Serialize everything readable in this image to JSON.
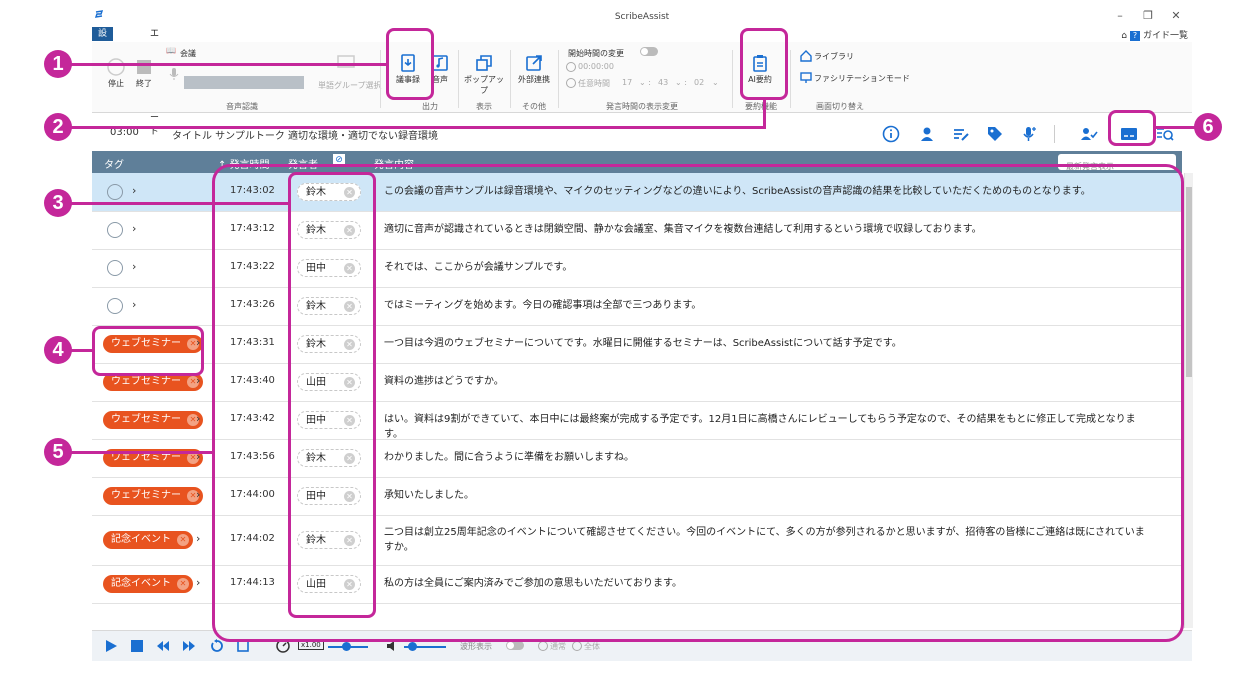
{
  "window": {
    "title": "ScribeAssist"
  },
  "menu": {
    "tabs": [
      "設定",
      "エディットモード"
    ],
    "help": "ガイド一覧"
  },
  "ribbon": {
    "stop": "停止",
    "end": "終了",
    "meeting_label": "会議",
    "wordgroup": "単語グループ選択",
    "group_speech": "音声認識",
    "minutes": "議事録",
    "audio": "音声",
    "output_group": "出力",
    "popup": "ポップアップ",
    "display_group": "表示",
    "external": "外部連携",
    "other_group": "その他",
    "start_time_change": "開始時間の変更",
    "time_zero": "00:00:00",
    "any_time": "任意時間",
    "hh": "17",
    "mm": "43",
    "ss": "02",
    "time_group": "発言時間の表示変更",
    "ai_summary": "AI要約",
    "ai_group": "要約機能",
    "library": "ライブラリ",
    "facilitation": "ファシリテーションモード",
    "screen_group": "画面切り替え"
  },
  "info": {
    "duration": "03:00",
    "title": "タイトル サンプルトーク 適切な環境・適切でない録音環境"
  },
  "table": {
    "headers": {
      "tag": "タグ",
      "time": "↑ 発言時間",
      "speaker": "発言者",
      "content": "発言内容"
    },
    "latest": "最新発言表示",
    "rows": [
      {
        "tag": "",
        "time": "17:43:02",
        "speaker": "鈴木",
        "text": "この会議の音声サンプルは録音環境や、マイクのセッティングなどの違いにより、ScribeAssistの音声認識の結果を比較していただくためのものとなります。"
      },
      {
        "tag": "",
        "time": "17:43:12",
        "speaker": "鈴木",
        "text": "適切に音声が認識されているときは閉鎖空間、静かな会議室、集音マイクを複数台連結して利用するという環境で収録しております。"
      },
      {
        "tag": "",
        "time": "17:43:22",
        "speaker": "田中",
        "text": "それでは、ここからが会議サンプルです。"
      },
      {
        "tag": "",
        "time": "17:43:26",
        "speaker": "鈴木",
        "text": "ではミーティングを始めます。今日の確認事項は全部で三つあります。"
      },
      {
        "tag": "ウェブセミナー",
        "time": "17:43:31",
        "speaker": "鈴木",
        "text": "一つ目は今週のウェブセミナーについてです。水曜日に開催するセミナーは、ScribeAssistについて話す予定です。"
      },
      {
        "tag": "ウェブセミナー",
        "time": "17:43:40",
        "speaker": "山田",
        "text": "資料の進捗はどうですか。"
      },
      {
        "tag": "ウェブセミナー",
        "time": "17:43:42",
        "speaker": "田中",
        "text": "はい。資料は9割ができていて、本日中には最終案が完成する予定です。12月1日に高橋さんにレビューしてもらう予定なので、その結果をもとに修正して完成となります。"
      },
      {
        "tag": "ウェブセミナー",
        "time": "17:43:56",
        "speaker": "鈴木",
        "text": "わかりました。間に合うように準備をお願いしますね。"
      },
      {
        "tag": "ウェブセミナー",
        "time": "17:44:00",
        "speaker": "田中",
        "text": "承知いたしました。"
      },
      {
        "tag": "記念イベント",
        "time": "17:44:02",
        "speaker": "鈴木",
        "text": "二つ目は創立25周年記念のイベントについて確認させてください。今回のイベントにて、多くの方が参列されるかと思いますが、招待客の皆様にご連絡は既にされていますか。"
      },
      {
        "tag": "記念イベント",
        "time": "17:44:13",
        "speaker": "山田",
        "text": "私の方は全員にご案内済みでご参加の意思もいただいております。"
      }
    ]
  },
  "player": {
    "speed": "x1.00",
    "waveform": "波形表示",
    "opt1": "通常",
    "opt2": "全体"
  },
  "callouts": [
    "1",
    "2",
    "3",
    "4",
    "5",
    "6"
  ]
}
